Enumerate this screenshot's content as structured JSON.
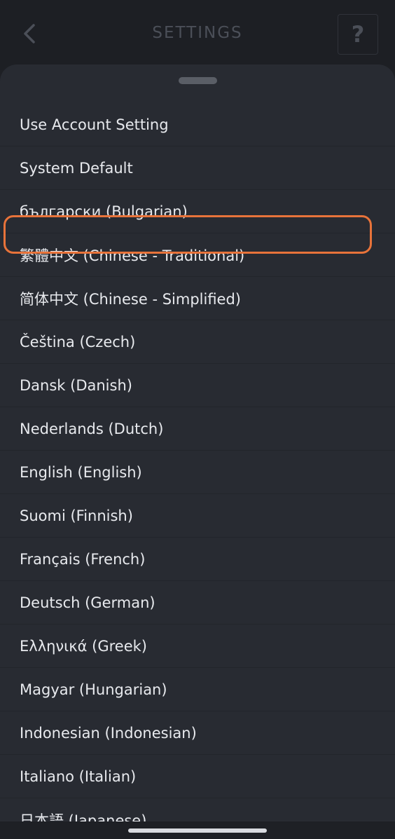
{
  "header": {
    "title": "SETTINGS",
    "help_label": "?",
    "back_icon": "chevron-left-icon"
  },
  "languages": [
    "Use Account Setting",
    "System Default",
    "български (Bulgarian)",
    "繁體中文 (Chinese - Traditional)",
    "简体中文 (Chinese - Simplified)",
    "Čeština (Czech)",
    "Dansk (Danish)",
    "Nederlands (Dutch)",
    "English (English)",
    "Suomi (Finnish)",
    "Français (French)",
    "Deutsch (German)",
    "Ελληνικά (Greek)",
    "Magyar (Hungarian)",
    "Indonesian (Indonesian)",
    "Italiano (Italian)",
    "日本語 (Japanese)"
  ],
  "colors": {
    "highlight": "#e8733a",
    "sheet_background": "#282b32",
    "text": "#e8eaee"
  }
}
